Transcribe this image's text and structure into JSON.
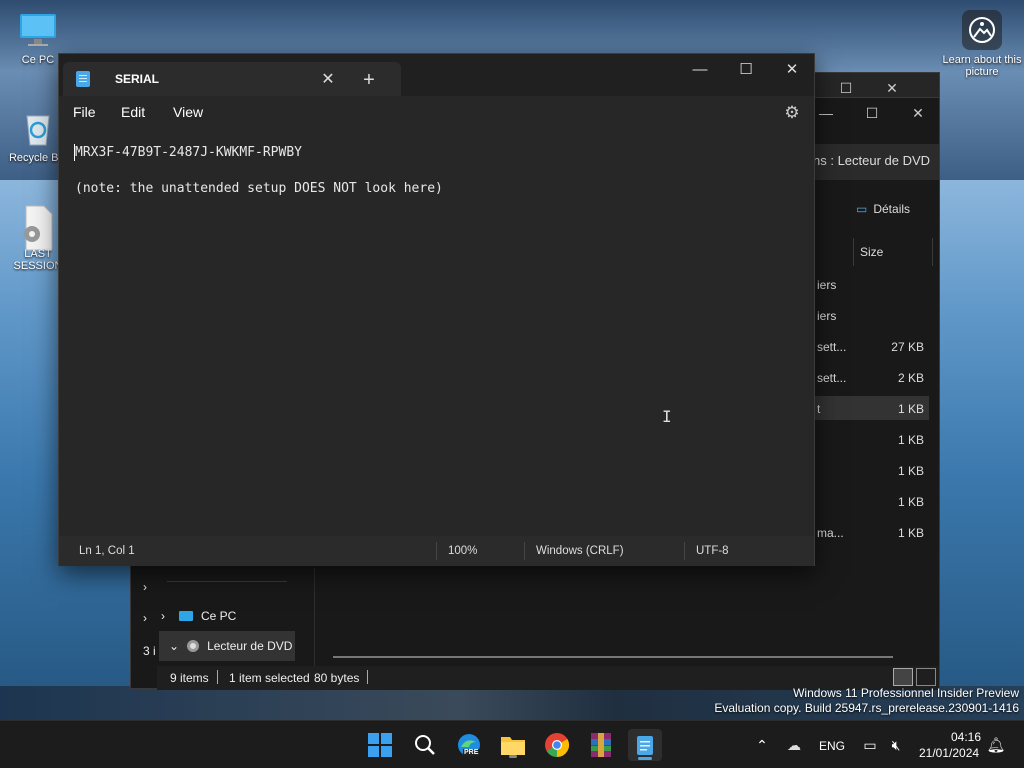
{
  "desktop": {
    "icons": [
      {
        "label": "Ce PC"
      },
      {
        "label": "Recycle Bin"
      },
      {
        "label": "LAST SESSION"
      }
    ],
    "learn_label": "Learn about this picture",
    "watermark_line1": "Windows 11 Professionnel Insider Preview",
    "watermark_line2": "Evaluation copy. Build 25947.rs_prerelease.230901-1416"
  },
  "explorer": {
    "address_text": "ns : Lecteur de DVD",
    "details_label": "Détails",
    "size_header": "Size",
    "rows": [
      {
        "name": "iers",
        "size": ""
      },
      {
        "name": "iers",
        "size": ""
      },
      {
        "name": "sett...",
        "size": "27 KB"
      },
      {
        "name": "sett...",
        "size": "2 KB"
      },
      {
        "name": "t",
        "size": "1 KB"
      },
      {
        "name": "",
        "size": "1 KB"
      },
      {
        "name": "",
        "size": "1 KB"
      },
      {
        "name": "",
        "size": "1 KB"
      },
      {
        "name": "ma...",
        "size": "1 KB"
      }
    ],
    "tree": [
      {
        "label": "Ce PC"
      },
      {
        "label": "Lecteur de DVD"
      }
    ],
    "status_items": "9 items",
    "status_selected": "1 item selected",
    "status_bytes": "80 bytes",
    "left_count": "3 i"
  },
  "notepad": {
    "tab_title": "SERIAL",
    "menu": [
      "File",
      "Edit",
      "View"
    ],
    "lines": [
      "MRX3F-47B9T-2487J-KWKMF-RPWBY",
      "",
      "(note: the unattended setup DOES NOT look here)"
    ],
    "status": {
      "position": "Ln 1, Col 1",
      "zoom": "100%",
      "line_ending": "Windows (CRLF)",
      "encoding": "UTF-8"
    }
  },
  "taskbar": {
    "language": "ENG",
    "time": "04:16",
    "date": "21/01/2024",
    "pre_badge": "PRE"
  },
  "colors": {
    "accent": "#4aa8e8",
    "window_bg": "#272727",
    "taskbar_bg": "#1c1c1c"
  }
}
